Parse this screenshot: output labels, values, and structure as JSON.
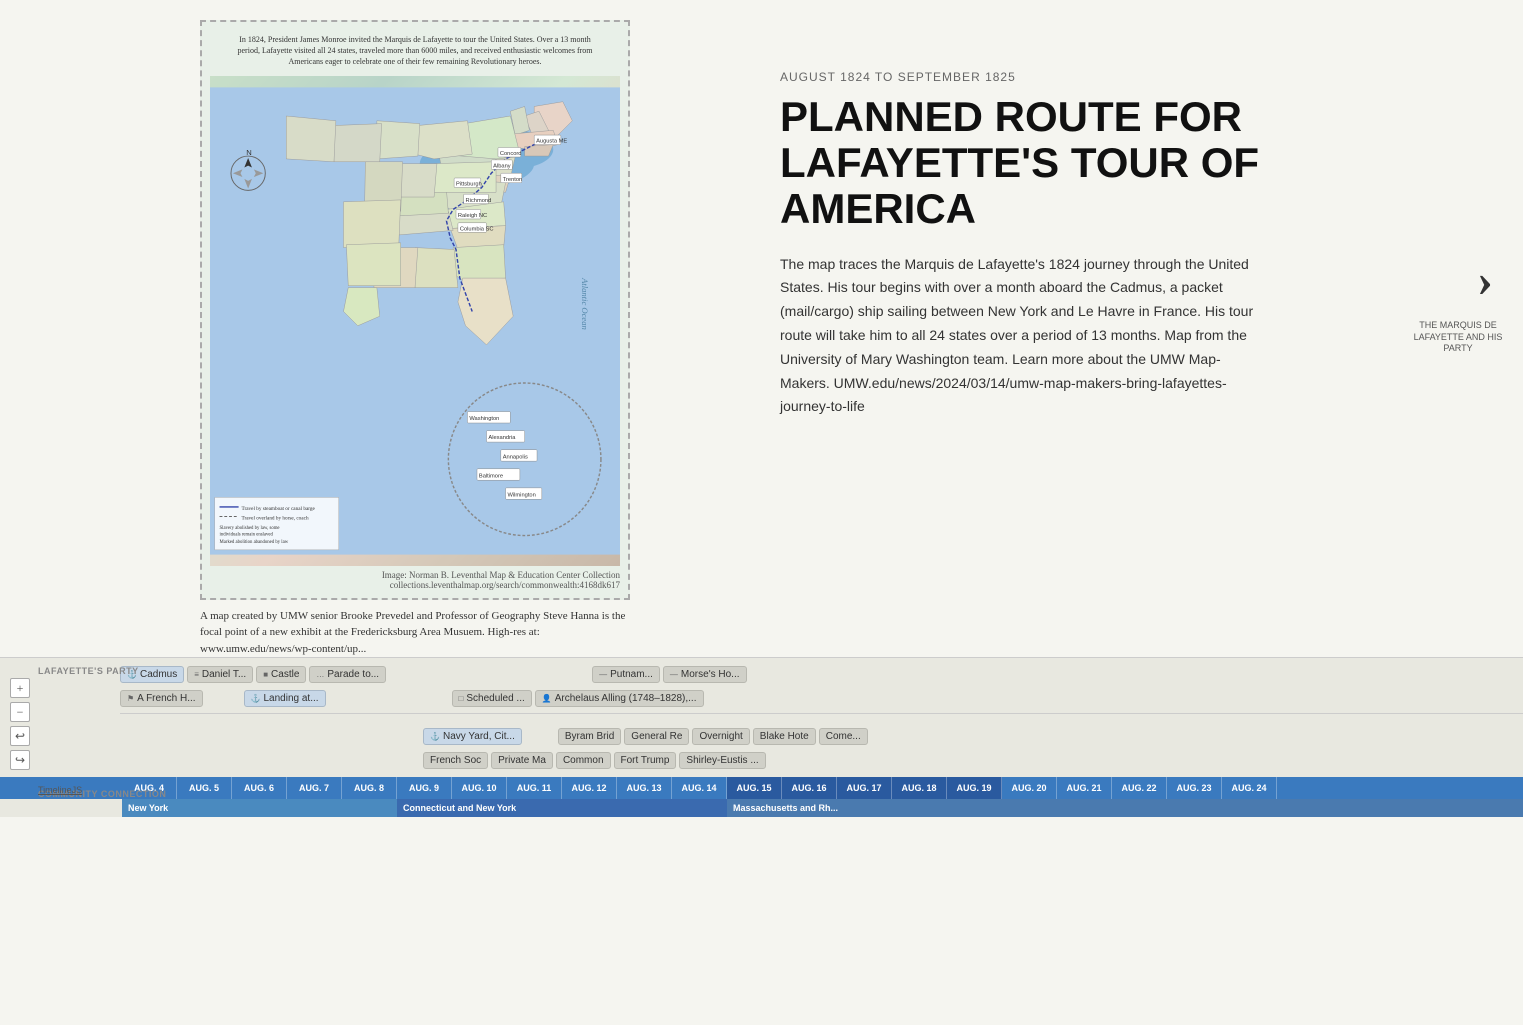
{
  "page": {
    "background": "#f5f5f0"
  },
  "map": {
    "title_text": "In 1824, President James Monroe invited the Marquis de Lafayette to tour the United States. Over a 13 month period, Lafayette visited all 24 states, traveled more than 6000 miles, and received enthusiastic welcomes from Americans eager to celebrate one of their few remaining Revolutionary heroes.",
    "caption": "Image: Norman B. Leventhal Map & Education Center Collection collections.leventhalmap.org/search/commonwealth:4168dk617",
    "description": "A map created by UMW senior Brooke Prevedel and Professor of Geography Steve Hanna is the focal point of a new exhibit at the Fredericksburg Area Musuem. High-res at: www.umw.edu/news/wp-content/up..."
  },
  "article": {
    "date_label": "AUGUST 1824 TO SEPTEMBER 1825",
    "title": "PLANNED ROUTE FOR LAFAYETTE'S TOUR OF AMERICA",
    "body": "The map traces the Marquis de Lafayette's 1824 journey through the United States. His tour begins with over a month aboard the Cadmus, a packet (mail/cargo) ship sailing between New York and Le Havre in France. His tour route will take him to all 24 states over a period of 13 months. Map from the University of Mary Washington team. Learn more about the UMW Map-Makers. UMW.edu/news/2024/03/14/umw-map-makers-bring-lafayettes-journey-to-life"
  },
  "next_slide": {
    "arrow": "›",
    "label": "THE MARQUIS DE LAFAYETTE AND HIS PARTY"
  },
  "timeline": {
    "sidebar_labels": [
      "LAFAYETTE'S PARTY",
      "COMMUNITY CONNECTION"
    ],
    "zoom_in": "+",
    "zoom_out": "−",
    "back": "↩",
    "forward": "↪",
    "timeline_link": "TimelineJS",
    "row1_chips": [
      {
        "icon": "⚓",
        "label": "Cadmus",
        "type": "blue"
      },
      {
        "icon": "👤",
        "label": "Daniel T...",
        "type": "default"
      },
      {
        "icon": "🏰",
        "label": "Castle",
        "type": "default"
      },
      {
        "icon": "🎭",
        "label": "Parade to...",
        "type": "default"
      },
      {
        "icon": "",
        "label": "",
        "type": "spacer-lg"
      },
      {
        "icon": "📍",
        "label": "Putnam...",
        "type": "default"
      },
      {
        "icon": "🏠",
        "label": "Morse's Ho...",
        "type": "default"
      }
    ],
    "row2_chips": [
      {
        "icon": "🏰",
        "label": "A French H...",
        "type": "default"
      },
      {
        "icon": "",
        "label": "",
        "type": "spacer-sm"
      },
      {
        "icon": "⚓",
        "label": "Landing at...",
        "type": "blue"
      },
      {
        "icon": "",
        "label": "",
        "type": "spacer-md"
      },
      {
        "icon": "📅",
        "label": "Scheduled ...",
        "type": "default"
      },
      {
        "icon": "👤",
        "label": "Archelaus Alling (1748–1828),...",
        "type": "default"
      }
    ],
    "row3_chips": [
      {
        "icon": "",
        "label": "",
        "type": "spacer-lg"
      },
      {
        "icon": "⚓",
        "label": "Navy Yard, Cit...",
        "type": "blue"
      },
      {
        "icon": "",
        "label": "",
        "type": "spacer-sm"
      },
      {
        "icon": "🏠",
        "label": "Byram Brid",
        "type": "default"
      },
      {
        "icon": "🏠",
        "label": "General Re",
        "type": "default"
      },
      {
        "icon": "🌙",
        "label": "Overnight",
        "type": "default"
      },
      {
        "icon": "🏨",
        "label": "Blake Hote",
        "type": "default"
      },
      {
        "icon": "🔔",
        "label": "Come...",
        "type": "default"
      }
    ],
    "row4_chips": [
      {
        "icon": "",
        "label": "",
        "type": "spacer-lg"
      },
      {
        "icon": "🏛",
        "label": "French Soc",
        "type": "default"
      },
      {
        "icon": "✉",
        "label": "Private Ma",
        "type": "default"
      },
      {
        "icon": "🏘",
        "label": "Common",
        "type": "default"
      },
      {
        "icon": "🏰",
        "label": "Fort Trump",
        "type": "default"
      },
      {
        "icon": "🏠",
        "label": "Shirley-Eustis ...",
        "type": "default"
      }
    ],
    "dates": [
      "AUG. 4",
      "AUG. 5",
      "AUG. 6",
      "AUG. 7",
      "AUG. 8",
      "AUG. 9",
      "AUG. 10",
      "AUG. 11",
      "AUG. 12",
      "AUG. 13",
      "AUG. 14",
      "AUG. 15",
      "AUG. 16",
      "AUG. 17",
      "AUG. 18",
      "AUG. 19",
      "AUG. 20",
      "AUG. 21",
      "AUG. 22",
      "AUG. 23",
      "AUG. 24"
    ],
    "regions": [
      {
        "label": "New York",
        "color": "#4a8abf"
      },
      {
        "label": "Connecticut and New York",
        "color": "#3a6aaf"
      },
      {
        "label": "Massachusetts and Rh...",
        "color": "#4a7aaf"
      }
    ]
  }
}
